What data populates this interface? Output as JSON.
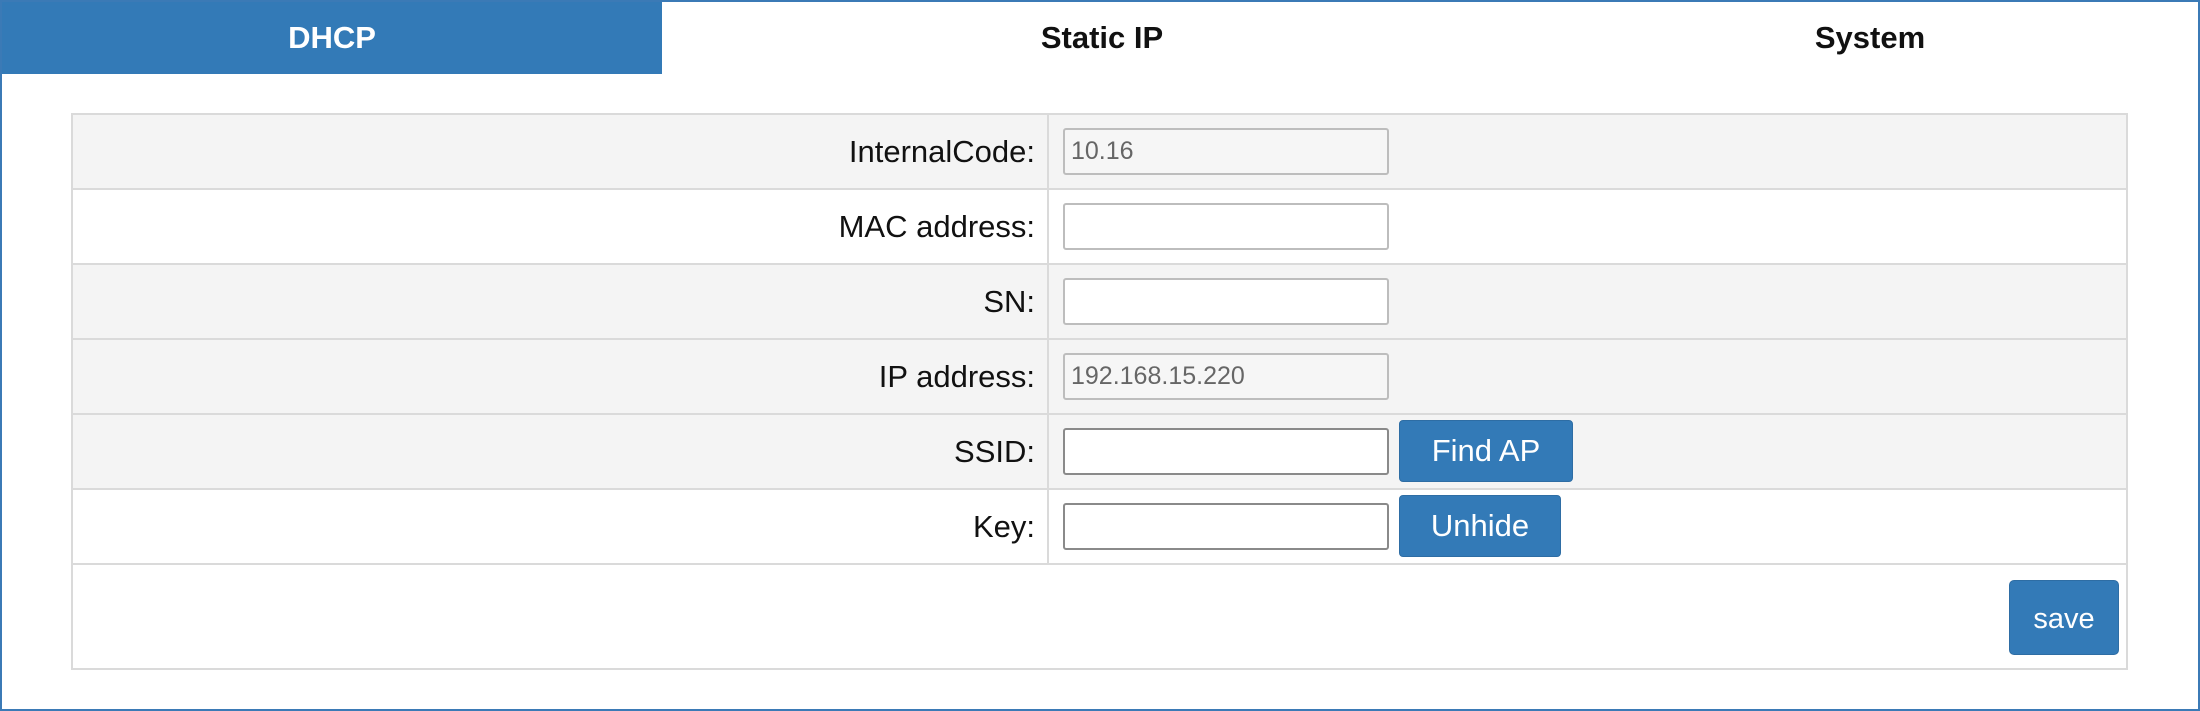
{
  "tabs": [
    {
      "label": "DHCP",
      "active": true
    },
    {
      "label": "Static IP",
      "active": false
    },
    {
      "label": "System",
      "active": false
    }
  ],
  "form": {
    "rows": [
      {
        "label": "InternalCode:",
        "value": "10.16",
        "readonly": true
      },
      {
        "label": "MAC address:",
        "value": "",
        "readonly": false
      },
      {
        "label": "SN:",
        "value": "",
        "readonly": false
      },
      {
        "label": "IP address:",
        "value": "192.168.15.220",
        "readonly": true
      },
      {
        "label": "SSID:",
        "value": "",
        "button": "Find AP"
      },
      {
        "label": "Key:",
        "value": "",
        "button": "Unhide"
      }
    ],
    "save_label": "save"
  },
  "colors": {
    "accent": "#337ab7",
    "border": "#dadada",
    "row_alt": "#f4f4f4"
  }
}
